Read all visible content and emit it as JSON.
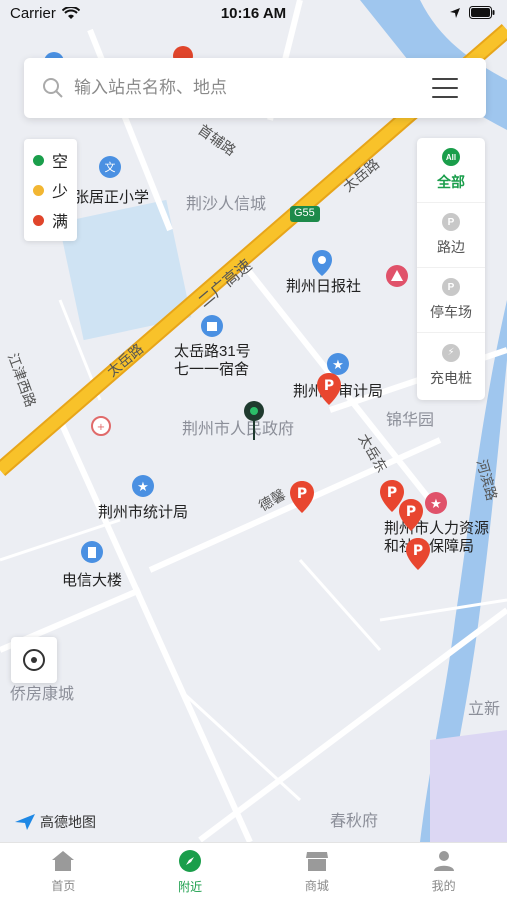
{
  "status_bar": {
    "carrier": "Carrier",
    "time": "10:16 AM"
  },
  "search": {
    "placeholder": "输入站点名称、地点"
  },
  "legend": [
    {
      "label": "空",
      "color": "#1a9e4b"
    },
    {
      "label": "少",
      "color": "#f2b632"
    },
    {
      "label": "满",
      "color": "#e0452b"
    }
  ],
  "filter": [
    {
      "label": "全部",
      "icon": "All",
      "active": true
    },
    {
      "label": "路边",
      "icon": "P",
      "active": false
    },
    {
      "label": "停车场",
      "icon": "P",
      "active": false
    },
    {
      "label": "充电桩",
      "icon": "⚡",
      "active": false
    }
  ],
  "map_labels": {
    "road_taiyue_1": "太岳路",
    "road_taiyue_2": "太岳路",
    "road_erguang": "二广高速",
    "road_shoufu": "首辅路",
    "road_jiangjin": "江津西路",
    "road_taiyue_dong": "太岳东",
    "road_hebin": "河滨路",
    "road_dexin": "德馨",
    "highway_badge": "G55",
    "school": "张居正小学",
    "jingsha_xincheng": "荆沙人信城",
    "jingzhou_ribao": "荆州日报社",
    "dormitory": "太岳路31号\n七一一宿舍",
    "gov": "荆州市人民政府",
    "audit": "荆州市审计局",
    "jinhuayuan": "锦华园",
    "stats": "荆州市统计局",
    "telecom": "电信大楼",
    "hr": "荆州市人力资源\n和社会保障局",
    "qiaofang": "侨房康城",
    "chunqiufu": "春秋府",
    "lixin": "立新",
    "amap_logo": "高德地图"
  },
  "tabs": [
    {
      "label": "首页",
      "active": false
    },
    {
      "label": "附近",
      "active": true
    },
    {
      "label": "商城",
      "active": false
    },
    {
      "label": "我的",
      "active": false
    }
  ]
}
